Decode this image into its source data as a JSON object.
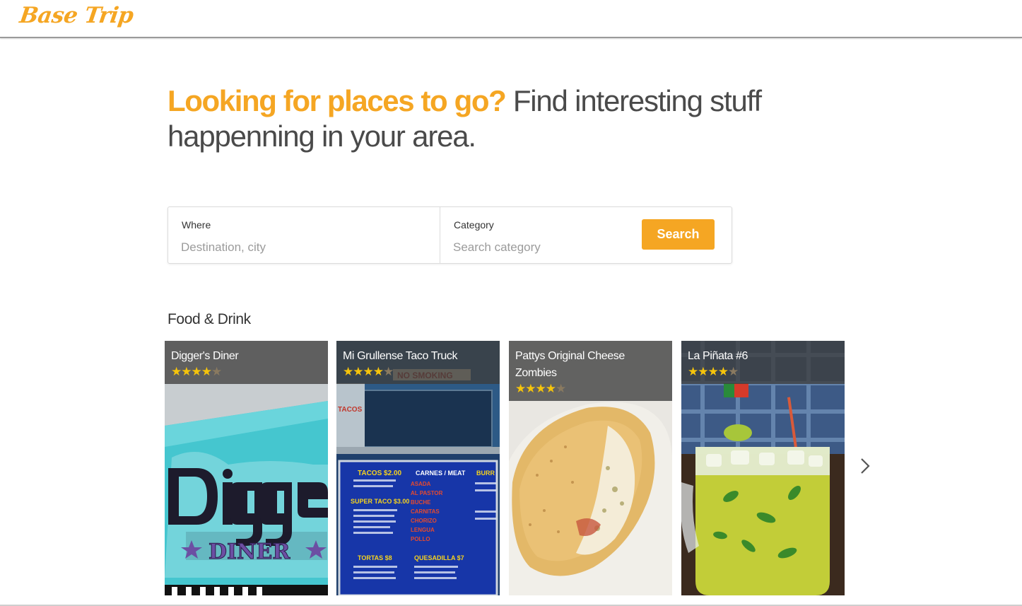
{
  "header": {
    "logo": "Base Trip"
  },
  "hero": {
    "accent": "Looking for places to go?",
    "rest": " Find interesting stuff happenning in your area."
  },
  "search": {
    "where_label": "Where",
    "where_placeholder": "Destination, city",
    "category_label": "Category",
    "category_placeholder": "Search category",
    "button": "Search"
  },
  "section": {
    "title": "Food & Drink"
  },
  "cards": [
    {
      "name": "Digger's Diner",
      "rating": 4.5,
      "stars": "★★★★",
      "half": "★"
    },
    {
      "name": "Mi Grullense Taco Truck",
      "rating": 4.5,
      "stars": "★★★★",
      "half": "★"
    },
    {
      "name": "Pattys Original Cheese Zombies",
      "rating": 4,
      "stars": "★★★★",
      "half": "★"
    },
    {
      "name": "La Piñata #6",
      "rating": 4.5,
      "stars": "★★★★",
      "half": "★"
    }
  ],
  "colors": {
    "accent": "#f5a623",
    "text": "#4a4a4a"
  },
  "icons": {
    "next": "chevron-right-icon",
    "star": "star-icon"
  }
}
